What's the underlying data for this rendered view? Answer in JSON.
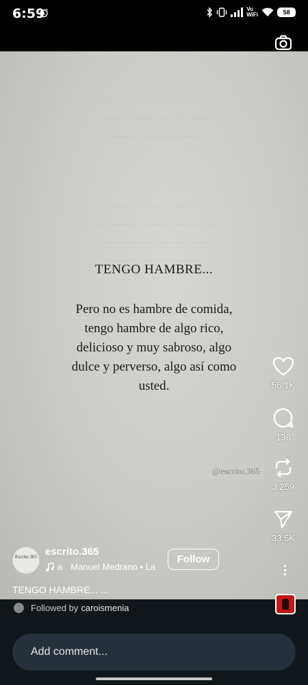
{
  "status_bar": {
    "time": "6:59",
    "network_label": "Vo\nWiFi",
    "battery": "58"
  },
  "reel": {
    "title": "TENGO HAMBRE...",
    "body": "Pero no es hambre de comida, tengo hambre de algo rico, delicioso y muy sabroso, algo dulce y perverso, algo así como usted.",
    "watermark": "@escrito.365",
    "avatar_text": "Escrito 365"
  },
  "actions": {
    "likes": "56.1K",
    "comments": "136",
    "reposts": "3,259",
    "shares": "33.5K"
  },
  "author": {
    "username": "escrito.365",
    "audio_prefix": "a",
    "audio_text": "Manuel Medrano • La",
    "follow_label": "Follow",
    "caption": "TENGO HAMBRE... ..."
  },
  "footer": {
    "followed_prefix": "Followed by",
    "followed_user": "caroismenia",
    "comment_placeholder": "Add comment..."
  },
  "colors": {
    "background": "#000000",
    "reel_paper": "#d6d6d2",
    "bottom_panel": "#10161a",
    "comment_box": "#25303a"
  }
}
